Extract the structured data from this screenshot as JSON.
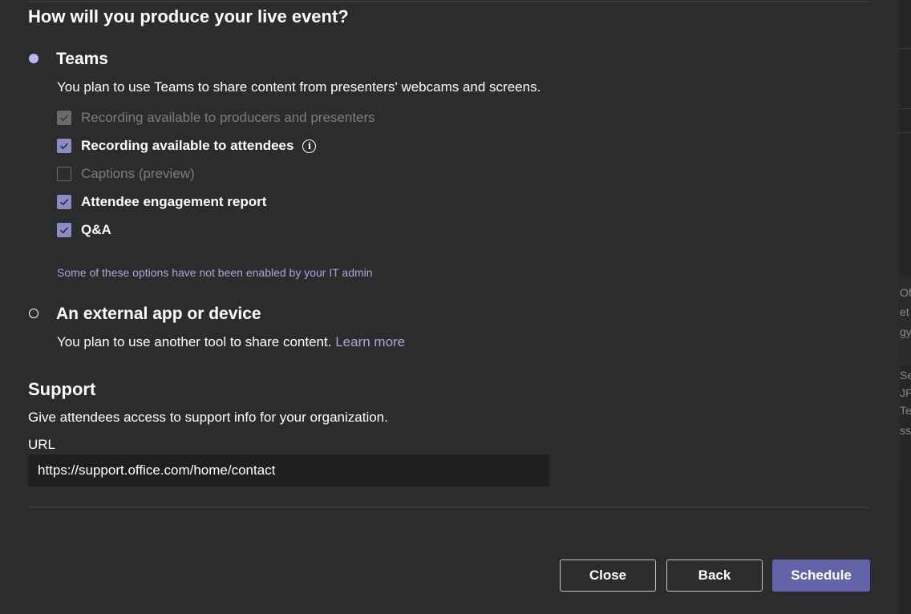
{
  "form": {
    "question": "How will you produce your live event?",
    "teams_option": {
      "title": "Teams",
      "selected": true,
      "description": "You plan to use Teams to share content from presenters' webcams and screens.",
      "checkboxes": [
        {
          "label": "Recording available to producers and presenters",
          "checked": true,
          "disabled": true
        },
        {
          "label": "Recording available to attendees",
          "checked": true,
          "disabled": false
        },
        {
          "label": "Captions (preview)",
          "checked": false,
          "disabled": true
        },
        {
          "label": "Attendee engagement report",
          "checked": true,
          "disabled": false
        },
        {
          "label": "Q&A",
          "checked": true,
          "disabled": false
        }
      ],
      "admin_note": "Some of these options have not been enabled by your IT admin"
    },
    "external_option": {
      "title": "An external app or device",
      "selected": false,
      "description": "You plan to use another tool to share content.",
      "learn_more": "Learn more"
    },
    "support": {
      "title": "Support",
      "description": "Give attendees access to support info for your organization.",
      "url_label": "URL",
      "url_value": "https://support.office.com/home/contact"
    }
  },
  "buttons": {
    "close": "Close",
    "back": "Back",
    "schedule": "Schedule"
  },
  "background_fragments": [
    "Off",
    "et",
    "gy",
    "Se",
    "JP",
    "Te",
    "ss"
  ],
  "colors": {
    "accent": "#6264a7",
    "checkbox_checked": "#8b8cc7",
    "link": "#a6a7dc",
    "dialog_bg": "#2d2c2c"
  }
}
